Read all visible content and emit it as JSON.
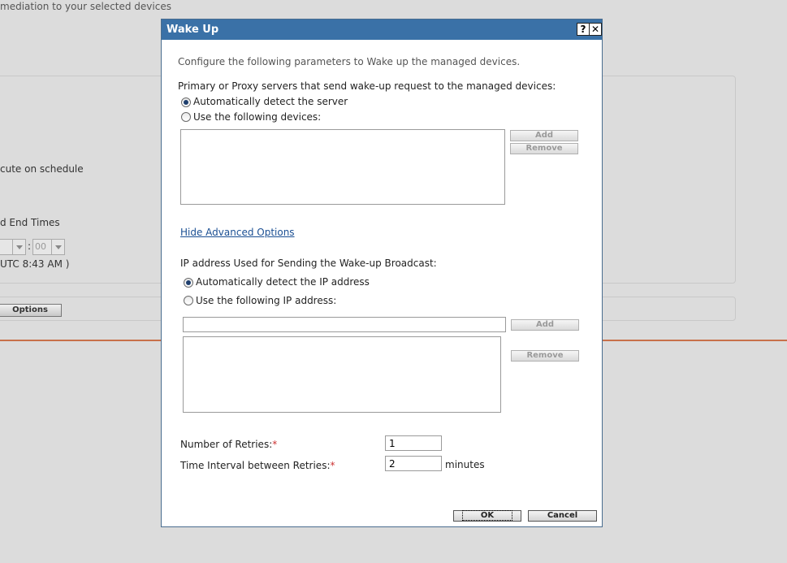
{
  "background": {
    "top_text": "mediation to your selected devices",
    "schedule_text": "cute on schedule",
    "times_text": "d End Times",
    "time_minutes": "00",
    "utc_text": "UTC 8:43 AM )",
    "options_button": "Options"
  },
  "dialog": {
    "title": "Wake Up",
    "help_glyph": "?",
    "close_glyph": "✕",
    "intro": "Configure the following parameters to Wake up the managed devices.",
    "servers": {
      "heading": "Primary or Proxy servers that send wake-up request to the managed devices:",
      "option_auto": "Automatically detect the server",
      "option_devices": "Use the following devices:",
      "add_label": "Add",
      "remove_label": "Remove"
    },
    "advanced_link": "Hide Advanced Options",
    "ip": {
      "heading": "IP address Used for Sending the Wake-up Broadcast:",
      "option_auto": "Automatically detect the IP address",
      "option_manual": "Use the following IP address:",
      "input_value": "",
      "add_label": "Add",
      "remove_label": "Remove"
    },
    "retries": {
      "label": "Number of Retries:",
      "required_mark": "*",
      "value": "1"
    },
    "interval": {
      "label": "Time Interval between Retries:",
      "required_mark": "*",
      "value": "2",
      "unit": "minutes"
    },
    "ok_label": "OK",
    "cancel_label": "Cancel"
  }
}
